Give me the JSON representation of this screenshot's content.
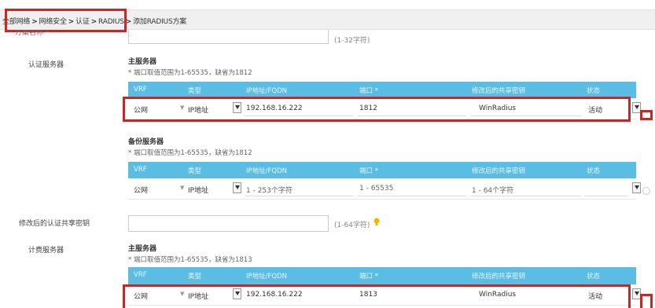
{
  "breadcrumb": {
    "items": [
      "全部网络",
      "网络安全",
      "认证",
      "RADIUS"
    ],
    "current": "添加RADIUS方案",
    "separator": ">"
  },
  "scheme_name": {
    "label": "方案名称 *",
    "value": "",
    "hint": "(1-32字符)"
  },
  "auth_servers": {
    "label": "认证服务器",
    "columns": [
      "VRF",
      "类型",
      "IP地址/FQDN",
      "端口 *",
      "修改后的共享密钥",
      "状态"
    ],
    "primary": {
      "title": "主服务器",
      "note": "* 端口取值范围为1-65535，缺省为1812",
      "row": {
        "vrf": "公网",
        "type": "IP地址",
        "ip": "192.168.16.222",
        "port": "1812",
        "key": "WinRadius",
        "status": "活动"
      }
    },
    "backup": {
      "title": "备份服务器",
      "note": "* 端口取值范围为1-65535，缺省为1812",
      "row": {
        "vrf": "公网",
        "type": "IP地址",
        "ip_placeholder": "1 - 253个字符",
        "port_placeholder": "1 - 65535",
        "key_placeholder": "1 - 64个字符",
        "status": ""
      }
    }
  },
  "auth_key": {
    "label": "修改后的认证共享密钥",
    "value": "",
    "hint": "(1-64字符)"
  },
  "acct_servers": {
    "label": "计费服务器",
    "columns": [
      "VRF",
      "类型",
      "IP地址/FQDN",
      "端口 *",
      "修改后的共享密钥",
      "状态"
    ],
    "primary": {
      "title": "主服务器",
      "note": "* 端口取值范围为1-65535，缺省为1813",
      "row": {
        "vrf": "公网",
        "type": "IP地址",
        "ip": "192.168.16.222",
        "port": "1813",
        "key": "WinRadius",
        "status": "活动"
      }
    }
  },
  "colors": {
    "header_bg": "#5bbde4",
    "highlight": "#c62828",
    "bulb": "#f5b400"
  }
}
